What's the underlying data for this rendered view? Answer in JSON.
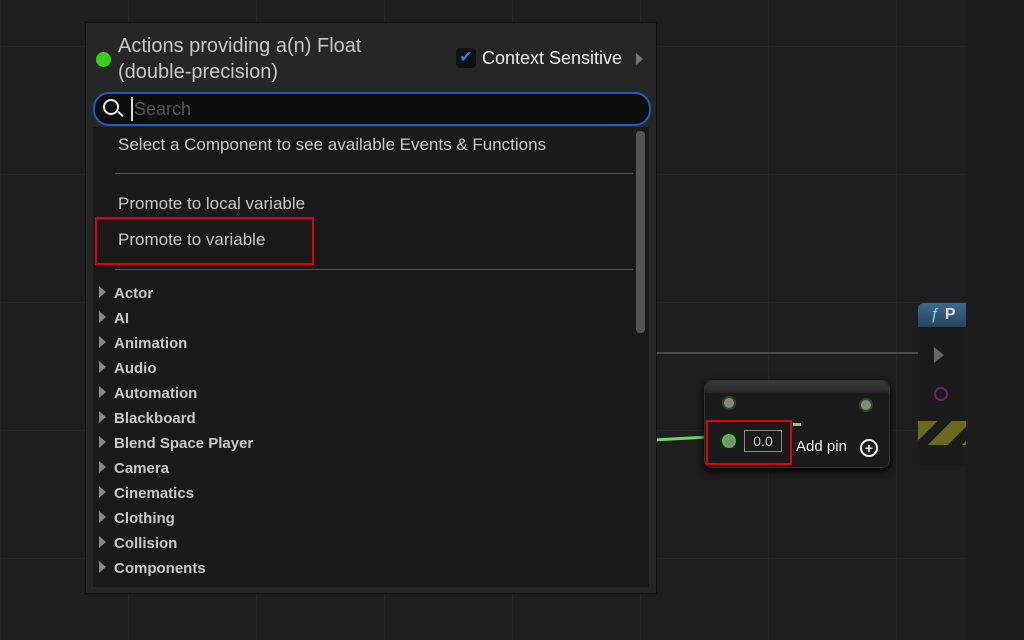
{
  "popup": {
    "title": "Actions providing a(n) Float (double-precision)",
    "context_sensitive_label": "Context Sensitive",
    "context_sensitive_checked": true,
    "search": {
      "placeholder": "Search",
      "value": ""
    },
    "info": "Select a Component to see available Events & Functions",
    "actions": [
      "Promote to local variable",
      "Promote to variable"
    ],
    "categories": [
      "Actor",
      "AI",
      "Animation",
      "Audio",
      "Automation",
      "Blackboard",
      "Blend Space Player",
      "Camera",
      "Cinematics",
      "Clothing",
      "Collision",
      "Components"
    ]
  },
  "node": {
    "value": "0.0",
    "add_pin_label": "Add pin"
  },
  "function_node": {
    "title": "P",
    "icon": "function-icon"
  },
  "colors": {
    "pin_float": "#38d01d",
    "highlight": "#e0000f",
    "search_border": "#1e5bc4"
  }
}
